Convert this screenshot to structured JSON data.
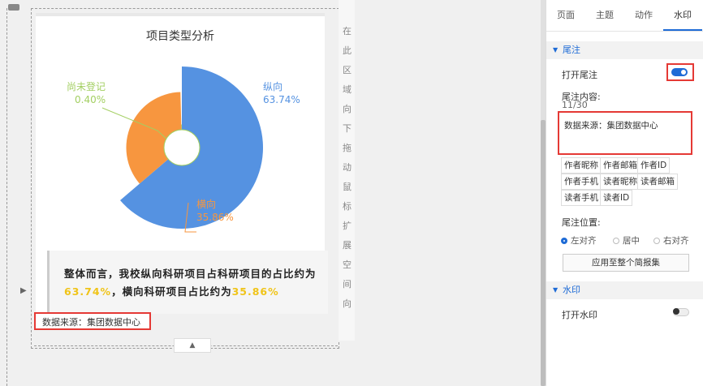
{
  "chart_data": {
    "type": "pie",
    "title": "项目类型分析",
    "categories": [
      "纵向",
      "横向",
      "尚未登记"
    ],
    "values": [
      63.74,
      35.86,
      0.4
    ],
    "value_labels": [
      "63.74%",
      "35.86%",
      "0.40%"
    ],
    "colors": [
      "#5592e1",
      "#f7963f",
      "#a3cf62"
    ]
  },
  "summary": {
    "text1": "整体而言，我校纵向科研项目占科研项目的占比约为",
    "pct1": "63.74%",
    "text2": "，横向科研项目占比约为",
    "pct2": "35.86%"
  },
  "source_label": "数据来源：集团数据中心",
  "vertical_hint": [
    "在",
    "此",
    "区",
    "域",
    "向",
    "下",
    "拖",
    "动",
    "鼠",
    "标",
    "扩",
    "展",
    "空",
    "间",
    "向"
  ],
  "panel": {
    "tabs": [
      "页面",
      "主题",
      "动作",
      "水印"
    ],
    "active_tab": "水印",
    "footnote_section": "尾注",
    "open_footnote": "打开尾注",
    "footnote_content_label": "尾注内容:",
    "footnote_count": "11/30",
    "footnote_text": "数据来源：集团数据中心",
    "chips": [
      "作者昵称",
      "作者邮箱",
      "作者ID",
      "作者手机",
      "读者昵称",
      "读者邮箱",
      "读者手机",
      "读者ID"
    ],
    "position_label": "尾注位置:",
    "align_options": [
      "左对齐",
      "居中",
      "右对齐"
    ],
    "apply_button": "应用至整个简报集",
    "watermark_section": "水印",
    "open_watermark": "打开水印"
  }
}
